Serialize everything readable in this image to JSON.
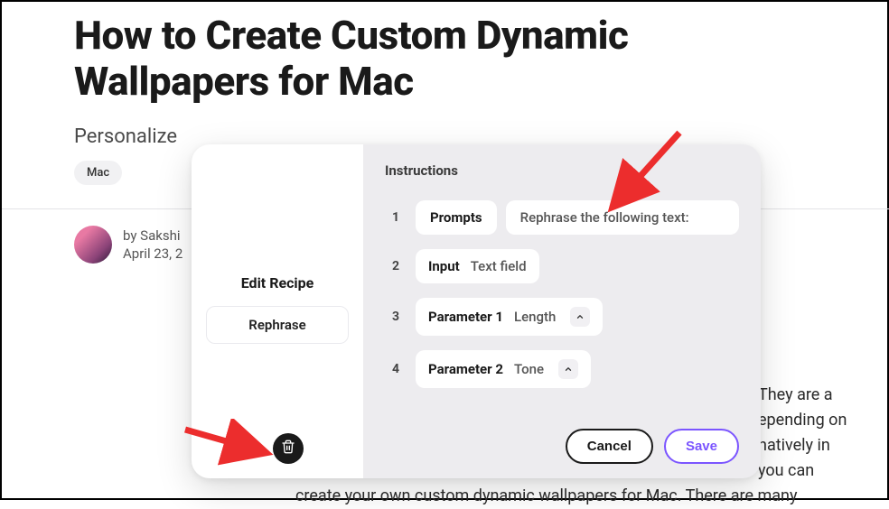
{
  "page": {
    "title": "How to Create Custom Dynamic Wallpapers for Mac",
    "subtitle": "Personalize ",
    "tag": "Mac",
    "author_prefix": "by ",
    "author": "Sakshi ",
    "date": "April 23, 2",
    "body_seg1": " They are a",
    "body_seg2": "epending on",
    "body_seg3": " natively in",
    "body_seg4": " you can",
    "body_seg5": "create your own custom dynamic wallpapers for Mac. There are many"
  },
  "modal": {
    "left_title": "Edit Recipe",
    "left_item": "Rephrase",
    "instructions_label": "Instructions",
    "rows": [
      {
        "num": "1",
        "label": "Prompts",
        "value": "Rephrase the following text:"
      },
      {
        "num": "2",
        "label": "Input",
        "value": "Text field"
      },
      {
        "num": "3",
        "label": "Parameter 1",
        "value": "Length"
      },
      {
        "num": "4",
        "label": "Parameter 2",
        "value": "Tone"
      }
    ],
    "cancel": "Cancel",
    "save": "Save"
  },
  "colors": {
    "accent": "#7b55ff",
    "annotation": "#ec2d2d"
  }
}
